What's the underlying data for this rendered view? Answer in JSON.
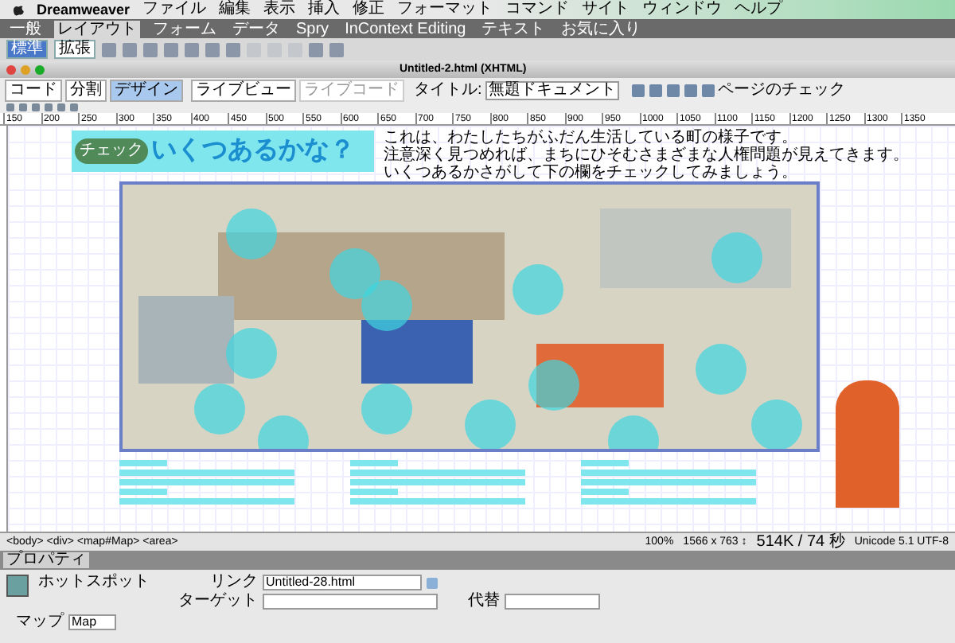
{
  "menu_bar": {
    "app": "Dreamweaver",
    "items": [
      "ファイル",
      "編集",
      "表示",
      "挿入",
      "修正",
      "フォーマット",
      "コマンド",
      "サイト",
      "ウィンドウ",
      "ヘルプ"
    ]
  },
  "insert_tabs": [
    {
      "label": "一般",
      "selected": false
    },
    {
      "label": "レイアウト",
      "selected": true
    },
    {
      "label": "フォーム",
      "selected": false
    },
    {
      "label": "データ",
      "selected": false
    },
    {
      "label": "Spry",
      "selected": false
    },
    {
      "label": "InContext Editing",
      "selected": false
    },
    {
      "label": "テキスト",
      "selected": false
    },
    {
      "label": "お気に入り",
      "selected": false
    }
  ],
  "layout_modes": [
    {
      "label": "標準",
      "selected": true
    },
    {
      "label": "拡張",
      "selected": false
    }
  ],
  "document": {
    "title": "Untitled-2.html (XHTML)",
    "view_buttons": [
      {
        "label": "コード",
        "selected": false
      },
      {
        "label": "分割",
        "selected": false
      },
      {
        "label": "デザイン",
        "selected": true
      }
    ],
    "live_view": "ライブビュー",
    "live_code": {
      "label": "ライブコード",
      "disabled": true
    },
    "title_label": "タイトル:",
    "title_value": "無題ドキュメント",
    "page_check": "ページのチェック",
    "ruler": [
      "150",
      "200",
      "250",
      "300",
      "350",
      "400",
      "450",
      "500",
      "550",
      "600",
      "650",
      "700",
      "750",
      "800",
      "850",
      "900",
      "950",
      "1000",
      "1050",
      "1100",
      "1150",
      "1200",
      "1250",
      "1300",
      "1350"
    ]
  },
  "page": {
    "badge": "チェック",
    "heading": "いくつあるかな？",
    "intro": [
      "これは、わたしたちがふだん生活している町の様子です。",
      "注意深く見つめれば、まちにひそむさまざまな人権問題が見えてきます。",
      "いくつあるかさがして下の欄をチェックしてみましょう。"
    ]
  },
  "status_bar": {
    "tags": "<body> <div> <map#Map> <area>",
    "zoom": "100%",
    "size": "1566 x 763 ↕",
    "weight": "514K / 74 秒",
    "encoding": "Unicode 5.1 UTF-8"
  },
  "properties": {
    "tab": "プロパティ",
    "type": "ホットスポット",
    "link_label": "リンク",
    "link": "Untitled-28.html",
    "target_label": "ターゲット",
    "alt_label": "代替",
    "map_label": "マップ",
    "map": "Map"
  }
}
